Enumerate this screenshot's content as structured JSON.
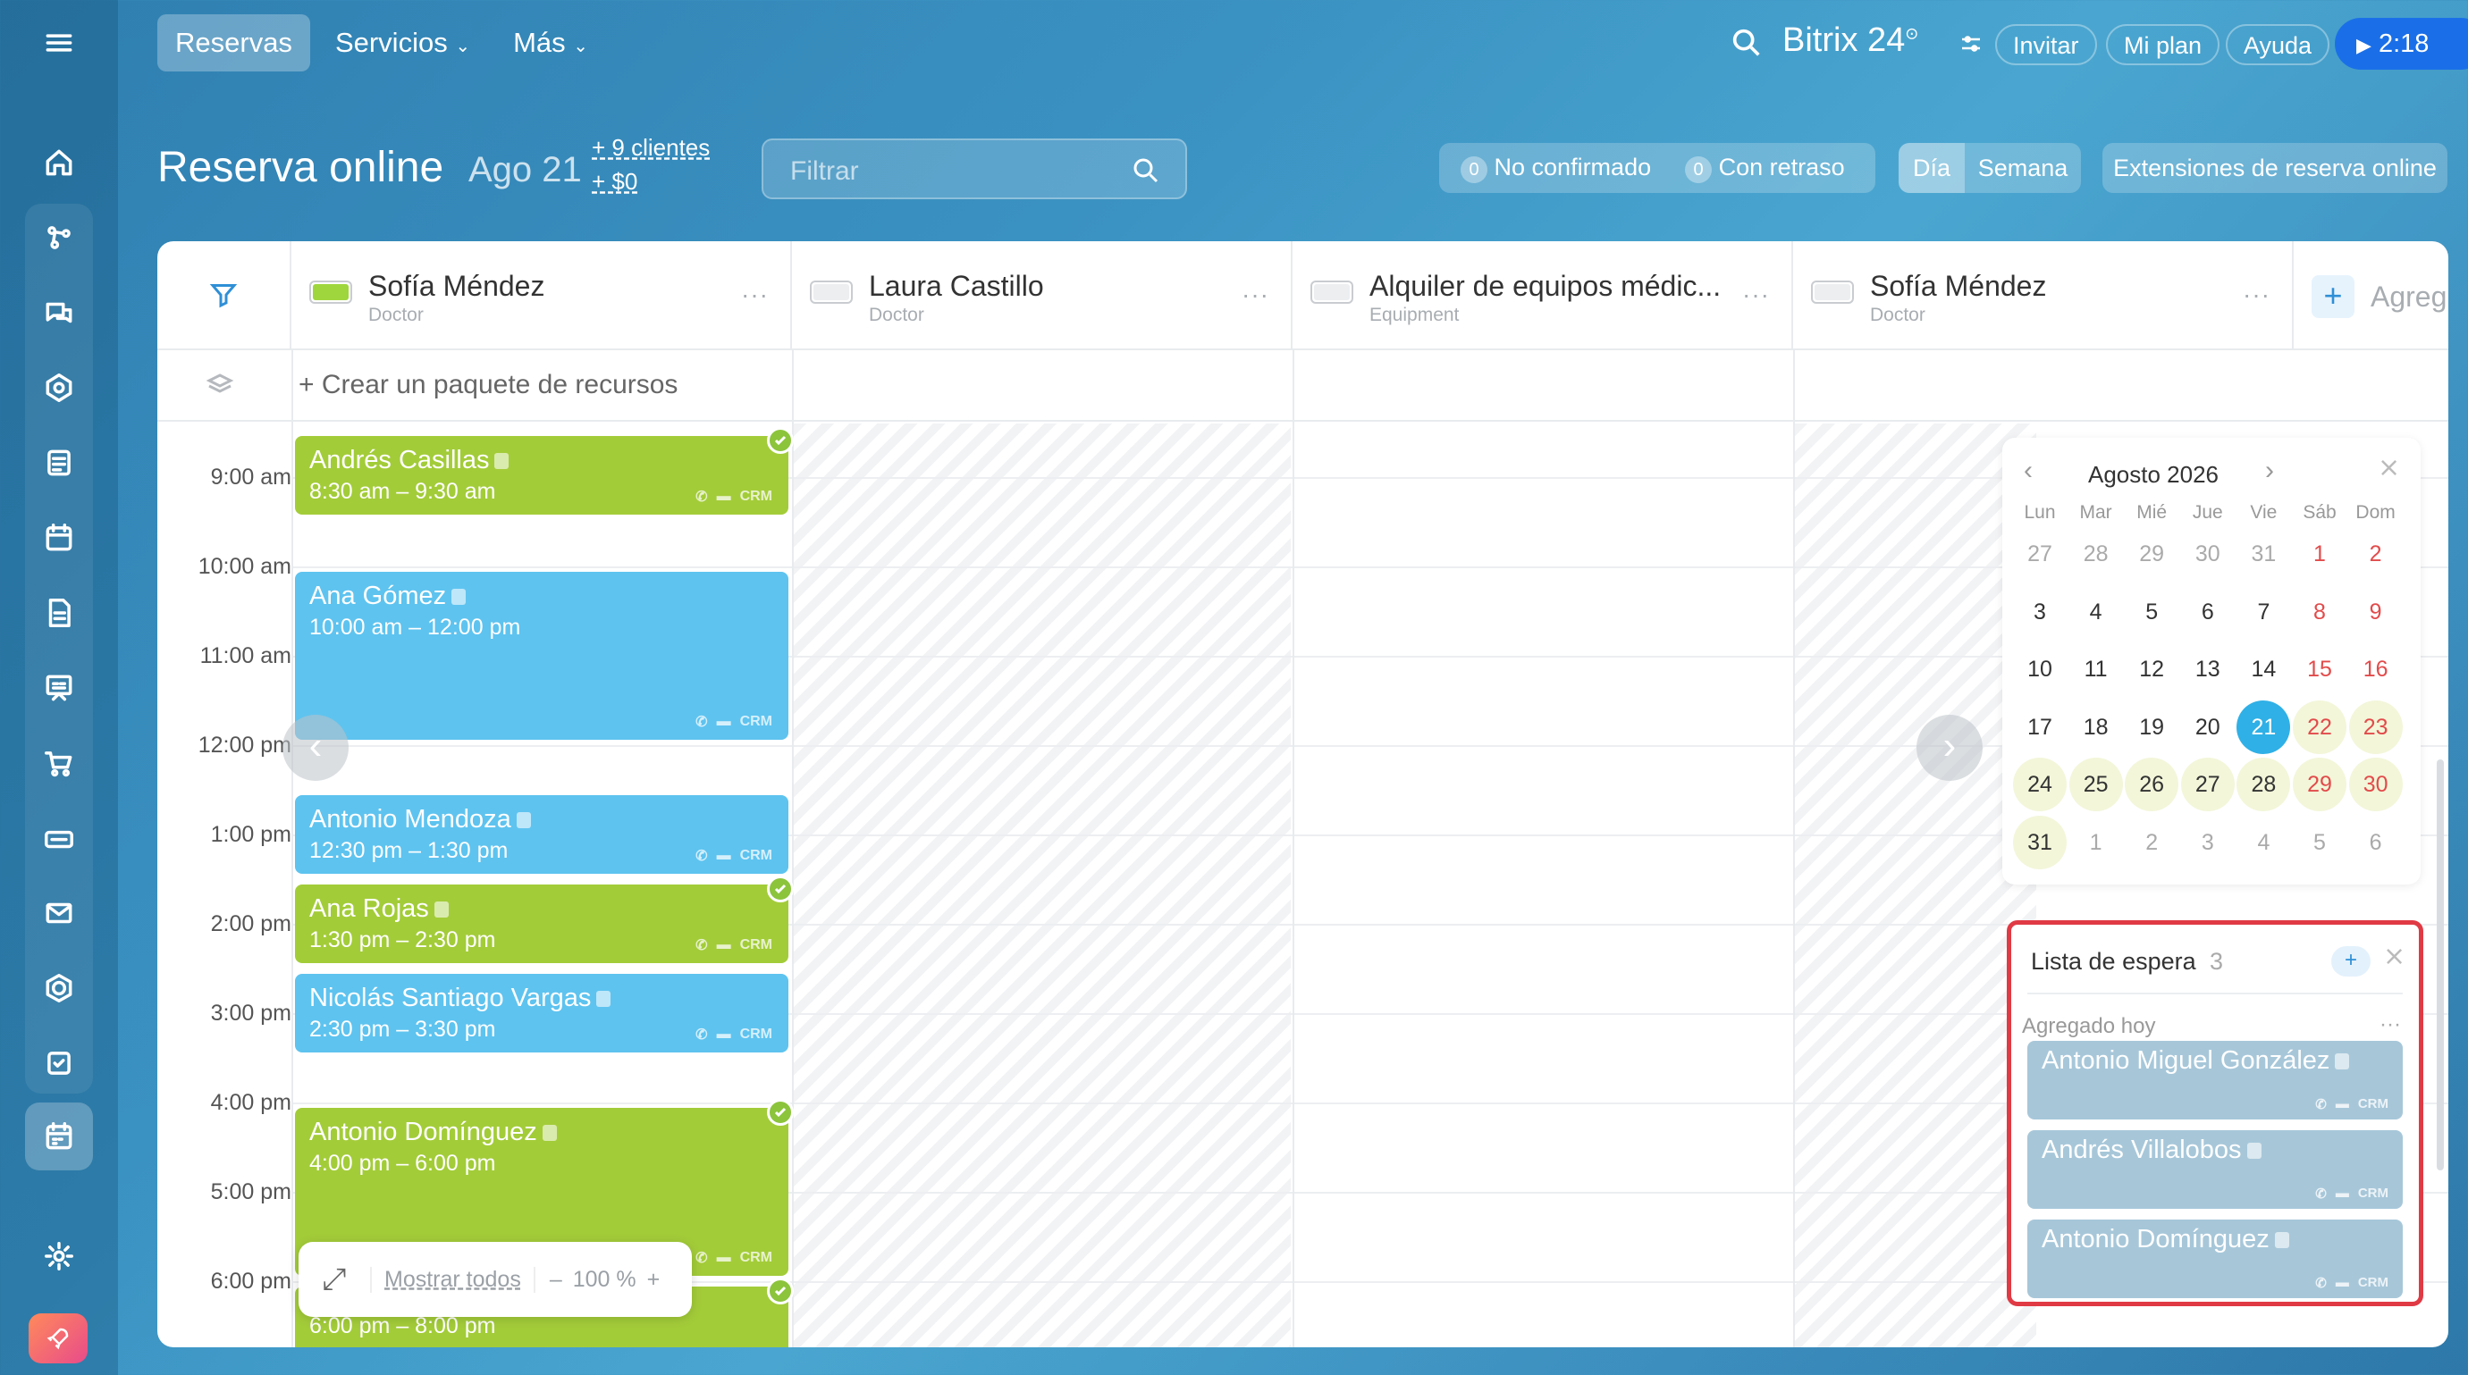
{
  "topnav": {
    "tabs": [
      "Reservas",
      "Servicios",
      "Más"
    ],
    "brand": "Bitrix 24",
    "invite": "Invitar",
    "plan": "Mi plan",
    "help": "Ayuda",
    "timer": "2:18"
  },
  "header": {
    "title": "Reserva online",
    "date": "Ago 21",
    "clients": "+ 9 clientes",
    "amount": "+ $0",
    "filter_placeholder": "Filtrar",
    "unconfirmed_count": "0",
    "unconfirmed": "No confirmado",
    "delayed_count": "0",
    "delayed": "Con retraso",
    "view_day": "Día",
    "view_week": "Semana",
    "extensions": "Extensiones de reserva online"
  },
  "resources": [
    {
      "name": "Sofía Méndez",
      "type": "Doctor",
      "color": "#9fd63d"
    },
    {
      "name": "Laura Castillo",
      "type": "Doctor",
      "color": "#e6e8ea"
    },
    {
      "name": "Alquiler de equipos médic...",
      "type": "Equipment",
      "color": "#e6e8ea"
    },
    {
      "name": "Sofía Méndez",
      "type": "Doctor",
      "color": "#e6e8ea"
    }
  ],
  "add_resource": "Agreg",
  "create_package": "+ Crear un paquete de recursos",
  "hours": [
    "9:00 am",
    "10:00 am",
    "11:00 am",
    "12:00 pm",
    "1:00 pm",
    "2:00 pm",
    "3:00 pm",
    "4:00 pm",
    "5:00 pm",
    "6:00 pm"
  ],
  "events": [
    {
      "name": "Andrés Casillas",
      "time": "8:30 am – 9:30 am",
      "color": "green"
    },
    {
      "name": "Ana Gómez",
      "time": "10:00 am – 12:00 pm",
      "color": "blue"
    },
    {
      "name": "Antonio Mendoza",
      "time": "12:30 pm – 1:30 pm",
      "color": "blue"
    },
    {
      "name": "Ana Rojas",
      "time": "1:30 pm – 2:30 pm",
      "color": "green"
    },
    {
      "name": "Nicolás Santiago Vargas",
      "time": "2:30 pm – 3:30 pm",
      "color": "blue"
    },
    {
      "name": "Antonio Domínguez",
      "time": "4:00 pm – 6:00 pm",
      "color": "green"
    },
    {
      "name": "",
      "time": "6:00 pm – 8:00 pm",
      "color": "green"
    }
  ],
  "crm": "CRM",
  "zoom": {
    "show_all": "Mostrar todos",
    "value": "100 %",
    "minus": "–",
    "plus": "+"
  },
  "calendar": {
    "month": "Agosto 2026",
    "weekdays": [
      "Lun",
      "Mar",
      "Mié",
      "Jue",
      "Vie",
      "Sáb",
      "Dom"
    ],
    "weeks": [
      [
        "27",
        "28",
        "29",
        "30",
        "31",
        "1",
        "2"
      ],
      [
        "3",
        "4",
        "5",
        "6",
        "7",
        "8",
        "9"
      ],
      [
        "10",
        "11",
        "12",
        "13",
        "14",
        "15",
        "16"
      ],
      [
        "17",
        "18",
        "19",
        "20",
        "21",
        "22",
        "23"
      ],
      [
        "24",
        "25",
        "26",
        "27",
        "28",
        "29",
        "30"
      ],
      [
        "31",
        "1",
        "2",
        "3",
        "4",
        "5",
        "6"
      ]
    ],
    "selected": "21"
  },
  "waitlist": {
    "title": "Lista de espera",
    "count": "3",
    "section": "Agregado hoy",
    "items": [
      "Antonio Miguel González",
      "Andrés Villalobos",
      "Antonio Domínguez"
    ]
  }
}
